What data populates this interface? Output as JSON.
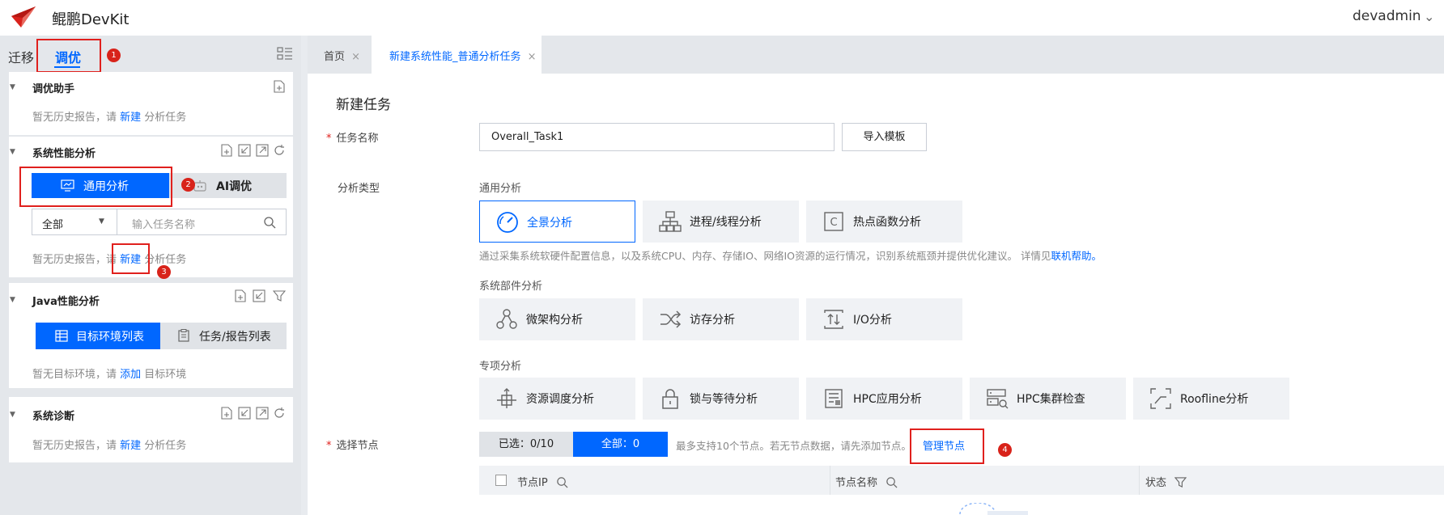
{
  "app": {
    "title": "鲲鹏DevKit",
    "user": "devadmin"
  },
  "left_tabs": {
    "migrate": "迁移",
    "tune": "调优"
  },
  "tuning_assistant": {
    "title": "调优助手",
    "hint_pre": "暂无历史报告，请 ",
    "hint_link": "新建",
    "hint_post": " 分析任务"
  },
  "system_perf": {
    "title": "系统性能分析",
    "btn_general": "通用分析",
    "btn_ai": "AI调优",
    "filter_value": "全部",
    "search_placeholder": "输入任务名称",
    "hint_pre": "暂无历史报告，请 ",
    "hint_link": "新建",
    "hint_post": " 分析任务"
  },
  "java_perf": {
    "title": "Java性能分析",
    "btn_targets": "目标环境列表",
    "btn_tasks": "任务/报告列表",
    "hint_pre": "暂无目标环境，请 ",
    "hint_link": "添加",
    "hint_post": " 目标环境"
  },
  "sys_diag": {
    "title": "系统诊断",
    "hint_pre": "暂无历史报告，请 ",
    "hint_link": "新建",
    "hint_post": " 分析任务"
  },
  "annotations": [
    "1",
    "2",
    "3",
    "4"
  ],
  "tabs": {
    "home": "首页",
    "new_task": "新建系统性能_普通分析任务"
  },
  "form": {
    "heading": "新建任务",
    "task_name_label": "任务名称",
    "task_name_value": "Overall_Task1",
    "import_button": "导入模板",
    "analysis_type_label": "分析类型",
    "general_section": "通用分析",
    "general_tiles": [
      "全景分析",
      "进程/线程分析",
      "热点函数分析"
    ],
    "description": "通过采集系统软硬件配置信息，以及系统CPU、内存、存储IO、网络IO资源的运行情况，识别系统瓶颈并提供优化建议。 详情见",
    "description_link": "联机帮助。",
    "component_section": "系统部件分析",
    "component_tiles": [
      "微架构分析",
      "访存分析",
      "I/O分析"
    ],
    "special_section": "专项分析",
    "special_tiles": [
      "资源调度分析",
      "锁与等待分析",
      "HPC应用分析",
      "HPC集群检查",
      "Roofline分析"
    ],
    "node_label": "选择节点",
    "node_selected": "已选：0/10",
    "node_all": "全部：0",
    "node_hint": "最多支持10个节点。若无节点数据，请先添加节点。",
    "node_manage": "管理节点",
    "col_ip": "节点IP",
    "col_name": "节点名称",
    "col_status": "状态"
  },
  "colors": {
    "accent": "#0067ff",
    "annotation": "#e0201d"
  }
}
